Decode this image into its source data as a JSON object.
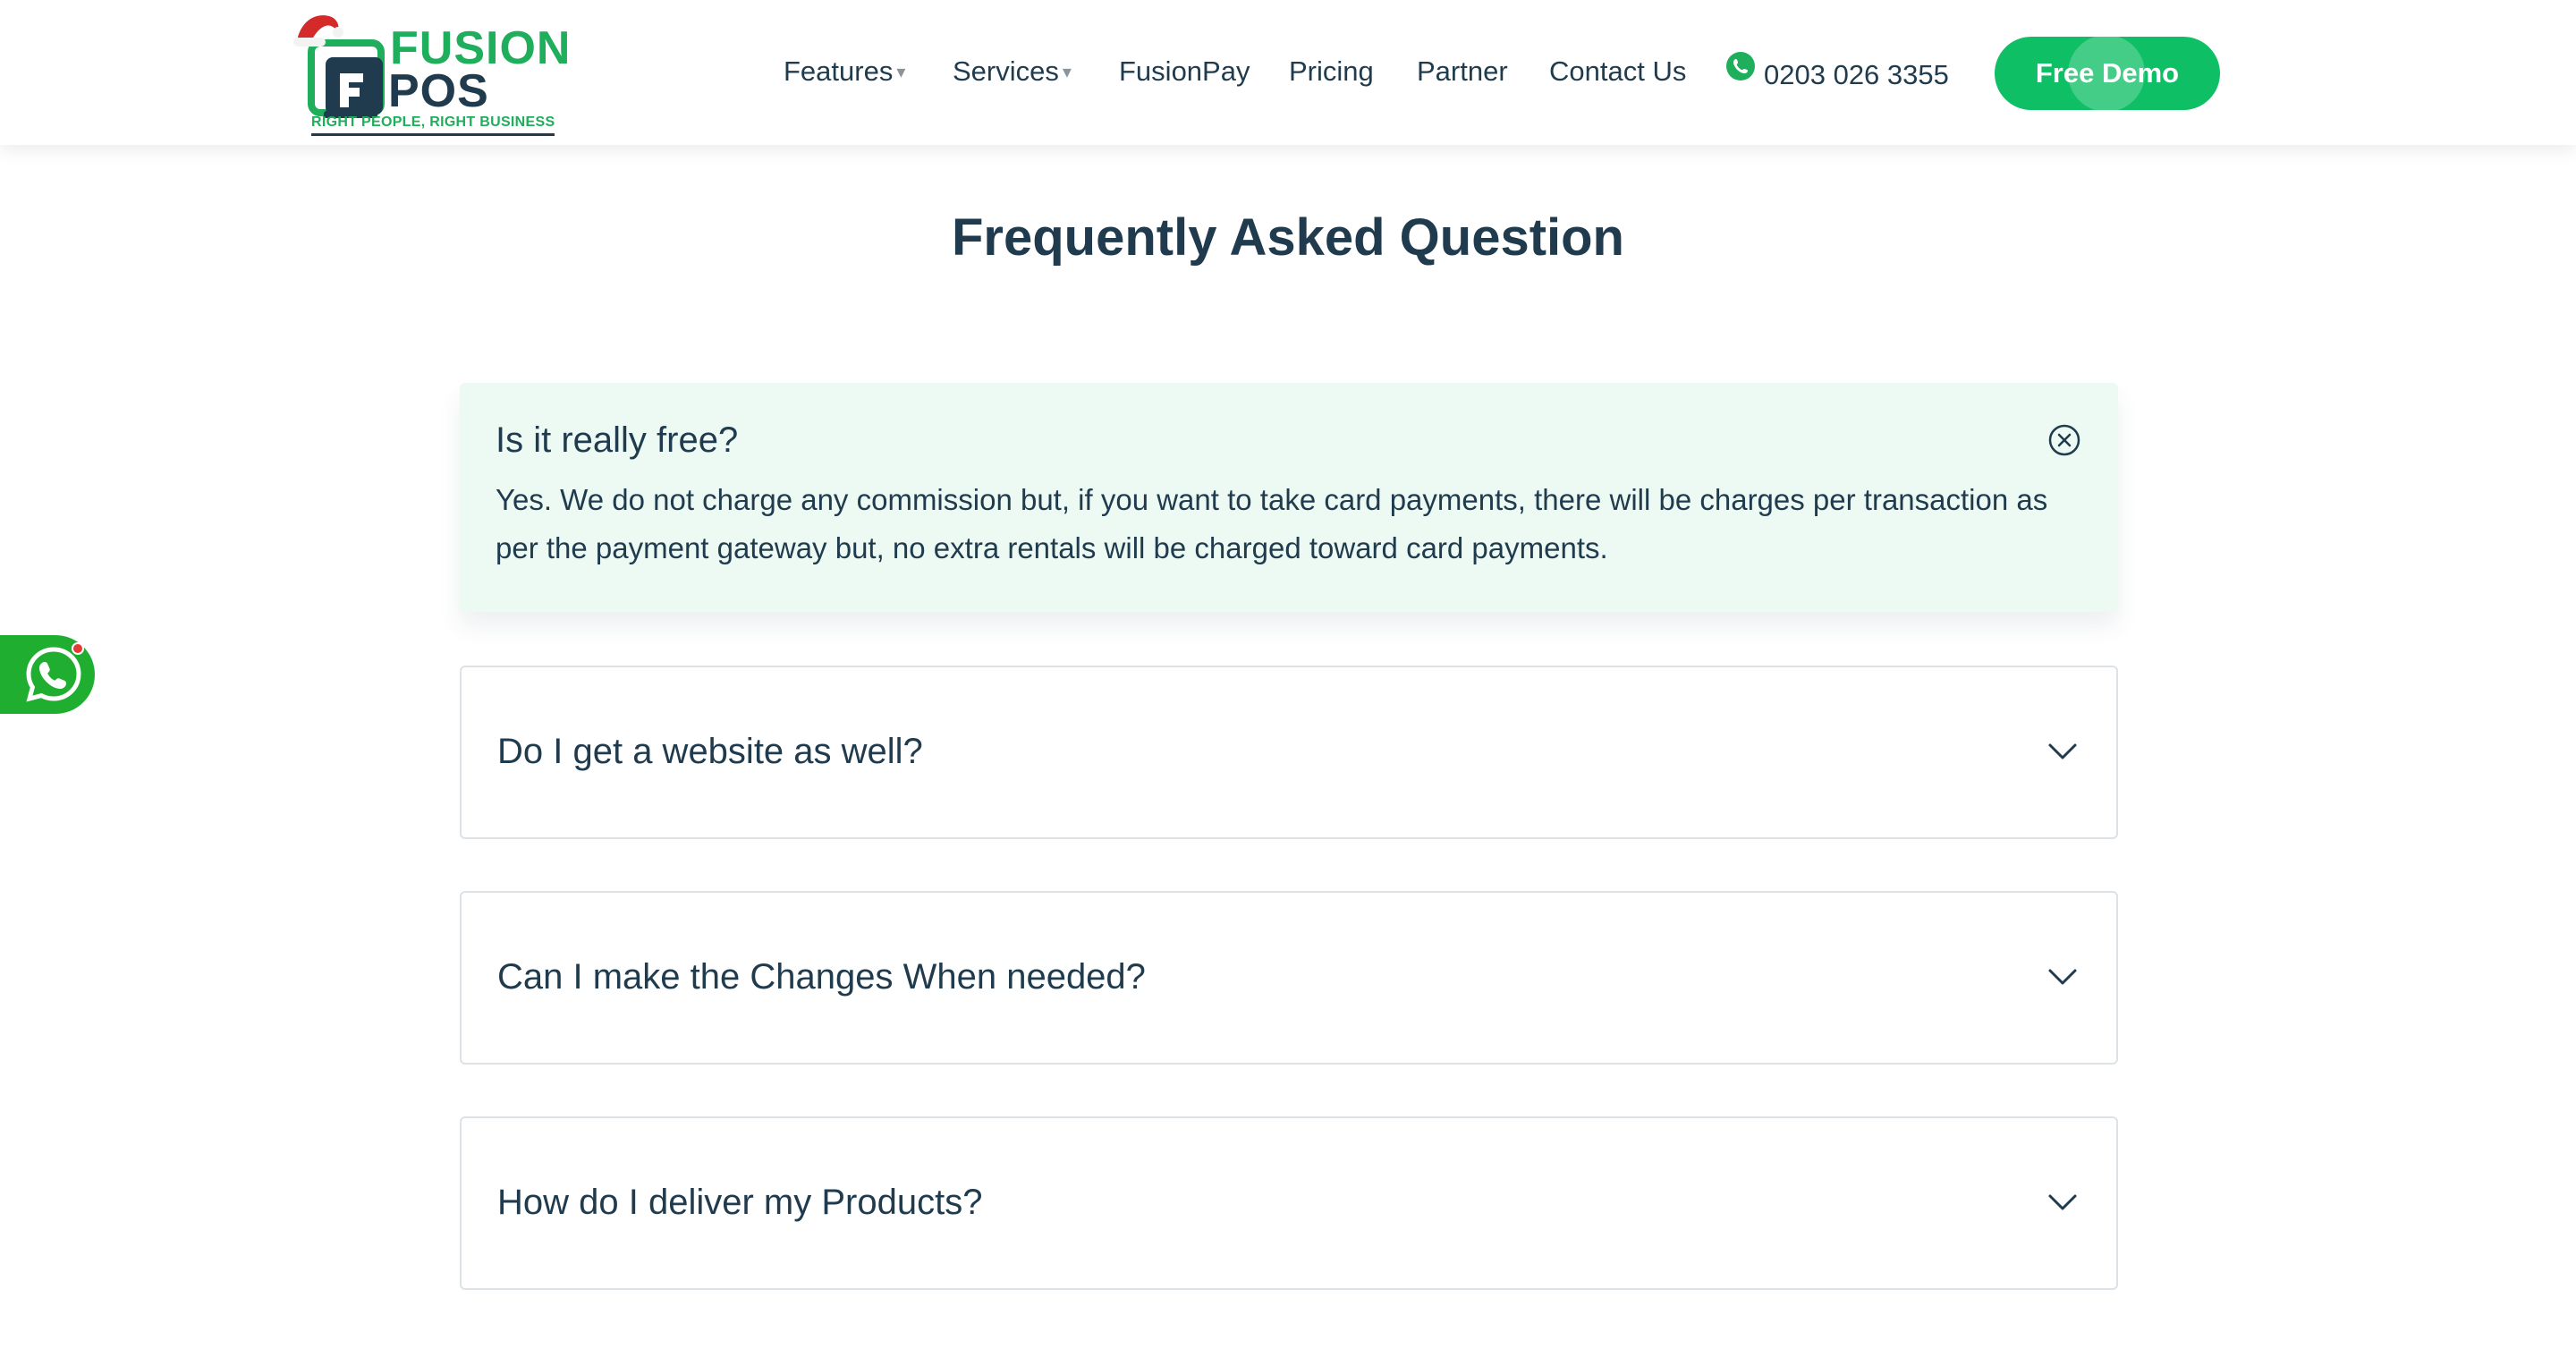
{
  "brand": {
    "word1": "FUSION",
    "word2": "POS",
    "tagline": "RIGHT PEOPLE, RIGHT BUSINESS",
    "colors": {
      "green": "#1fae5b",
      "navy": "#1f3b4d",
      "button": "#0fbf66"
    }
  },
  "nav": {
    "items": [
      {
        "label": "Features",
        "caret": "▾"
      },
      {
        "label": "Services",
        "caret": "▾"
      },
      {
        "label": "FusionPay"
      },
      {
        "label": "Pricing"
      },
      {
        "label": "Partner"
      },
      {
        "label": "Contact Us"
      }
    ],
    "phone": "0203 026 3355",
    "cta": "Free Demo"
  },
  "faq": {
    "title": "Frequently Asked Question",
    "items": [
      {
        "question": "Is it really free?",
        "answer": "Yes. We do not charge any commission but, if you want to take card payments, there will be charges per transaction as per the payment gateway but, no extra rentals will be charged toward card payments.",
        "expanded": true,
        "icon": "close-circle-icon"
      },
      {
        "question": "Do I get a website as well?",
        "expanded": false,
        "icon": "chevron-down-icon"
      },
      {
        "question": "Can I make the Changes When needed?",
        "expanded": false,
        "icon": "chevron-down-icon"
      },
      {
        "question": "How do I deliver my Products?",
        "expanded": false,
        "icon": "chevron-down-icon"
      }
    ]
  },
  "whatsapp": {
    "icon": "whatsapp-icon"
  }
}
